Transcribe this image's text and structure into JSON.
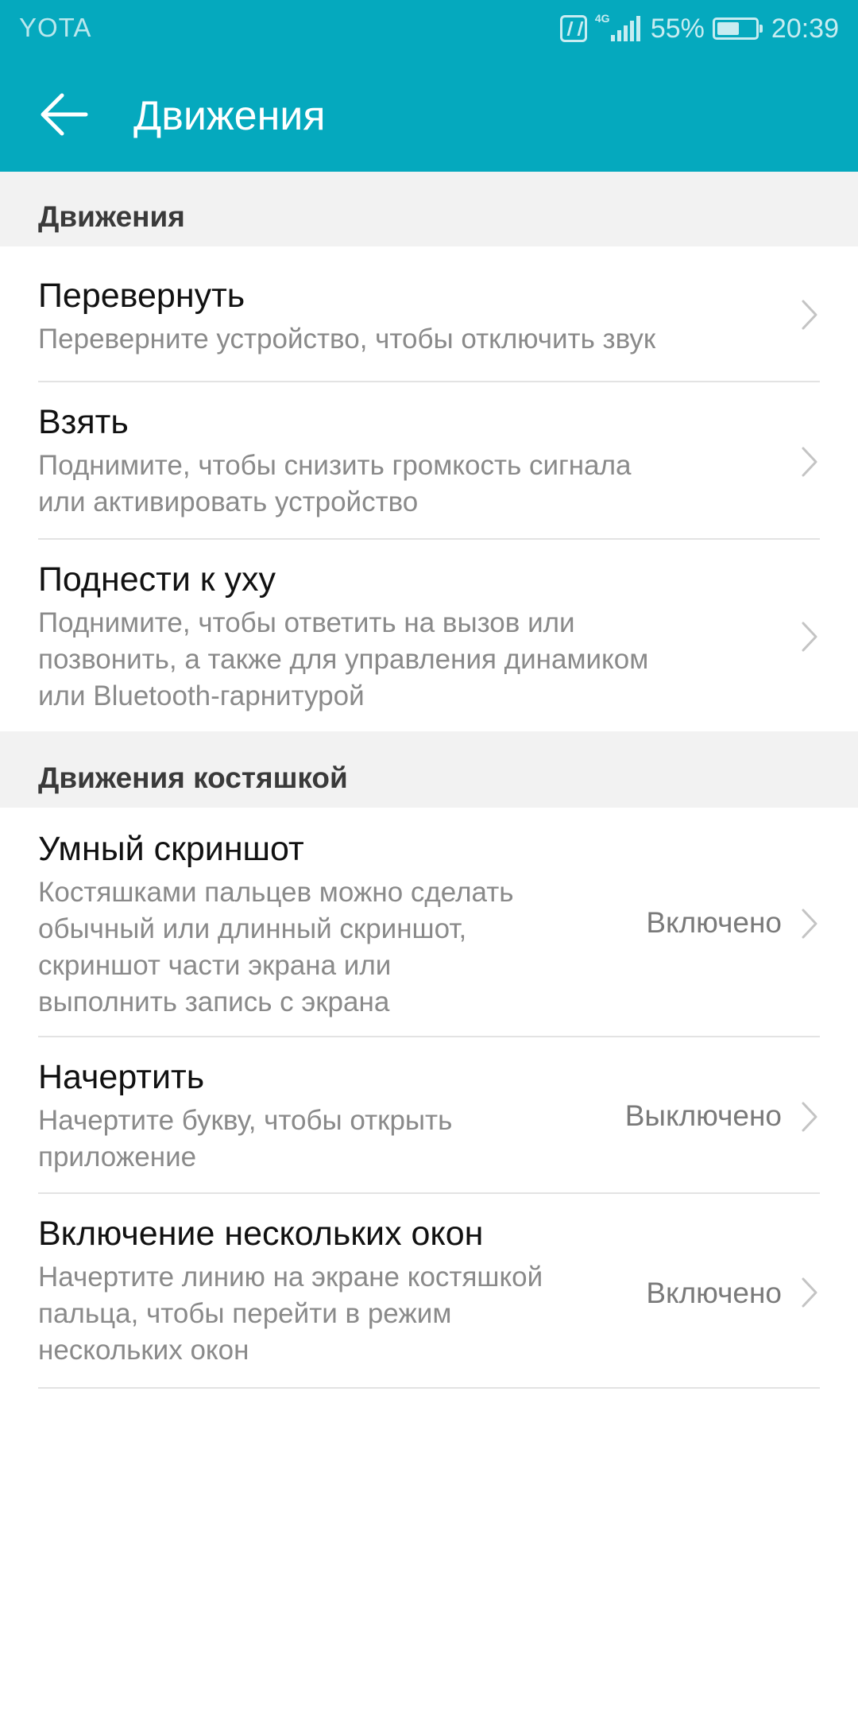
{
  "status_bar": {
    "carrier": "YOTA",
    "network": "4G",
    "battery": "55%",
    "time": "20:39"
  },
  "toolbar": {
    "title": "Движения"
  },
  "sections": [
    {
      "title": "Движения",
      "items": [
        {
          "title": "Перевернуть",
          "desc": [
            "Переверните устройство, чтобы отключить звук"
          ]
        },
        {
          "title": "Взять",
          "desc": [
            "Поднимите, чтобы снизить громкость сигнала",
            "или активировать устройство"
          ]
        },
        {
          "title": "Поднести к уху",
          "desc": [
            "Поднимите, чтобы ответить на вызов или",
            "позвонить, а также для управления динамиком",
            "или Bluetooth-гарнитурой"
          ]
        }
      ]
    },
    {
      "title": "Движения костяшкой",
      "items": [
        {
          "title": "Умный скриншот",
          "desc": [
            "Костяшками пальцев можно сделать",
            "обычный или длинный скриншот,",
            "скриншот части экрана или",
            "выполнить запись с экрана"
          ],
          "value": "Включено"
        },
        {
          "title": "Начертить",
          "desc": [
            "Начертите букву, чтобы открыть",
            "приложение"
          ],
          "value": "Выключено"
        },
        {
          "title": "Включение нескольких окон",
          "desc": [
            "Начертите линию на экране костяшкой",
            "пальца, чтобы перейти в режим",
            "нескольких окон"
          ],
          "value": "Включено"
        }
      ]
    }
  ],
  "colors": {
    "header": "#05A9BE",
    "section_bg": "#F2F2F2",
    "title_text": "#111111",
    "secondary_text": "#8a8a8a"
  },
  "icons": {
    "back": "arrow-left-icon",
    "chevron": "chevron-right-icon",
    "nfc": "nfc-icon",
    "signal": "signal-icon",
    "battery": "battery-icon"
  }
}
